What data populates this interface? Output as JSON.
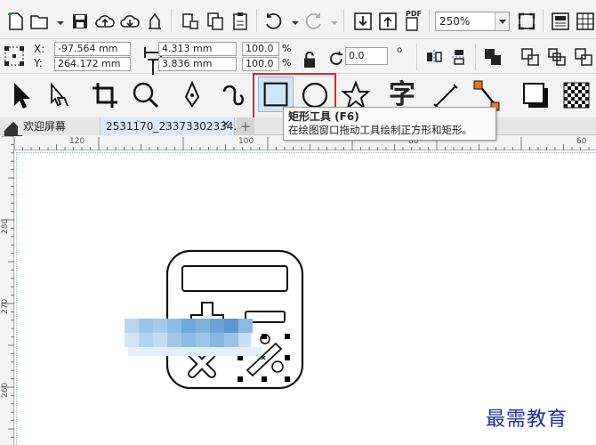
{
  "toolbar": {
    "zoom_value": "250%",
    "pdf_label": "PDF"
  },
  "property_bar": {
    "x_label": "X:",
    "y_label": "Y:",
    "x_value": "-97.564 mm",
    "y_value": "264.172 mm",
    "width_value": "4.313 mm",
    "height_value": "3.836 mm",
    "scale_w": "100.0",
    "scale_h": "100.0",
    "percent_symbol": "%",
    "rotation_value": "0.0",
    "degree_symbol": "o"
  },
  "toolbox": {
    "text_tool_glyph": "字"
  },
  "tabs": {
    "welcome": "欢迎屏幕",
    "document": "2531170_23373302334..*",
    "close_symbol": "×",
    "add_symbol": "+"
  },
  "ruler": {
    "h_ticks": [
      "120",
      "100",
      "80",
      "60"
    ],
    "v_ticks": [
      "280",
      "270",
      "260"
    ]
  },
  "tooltip": {
    "title": "矩形工具 (F6)",
    "description": "在绘图窗口拖动工具绘制正方形和矩形。"
  },
  "watermark": "最需教育",
  "colors": {
    "highlight": "#e0262b",
    "selection_fill": "#cfe4f5",
    "blur_blue": "#6ea8d8",
    "watermark": "#1b2fa6"
  }
}
